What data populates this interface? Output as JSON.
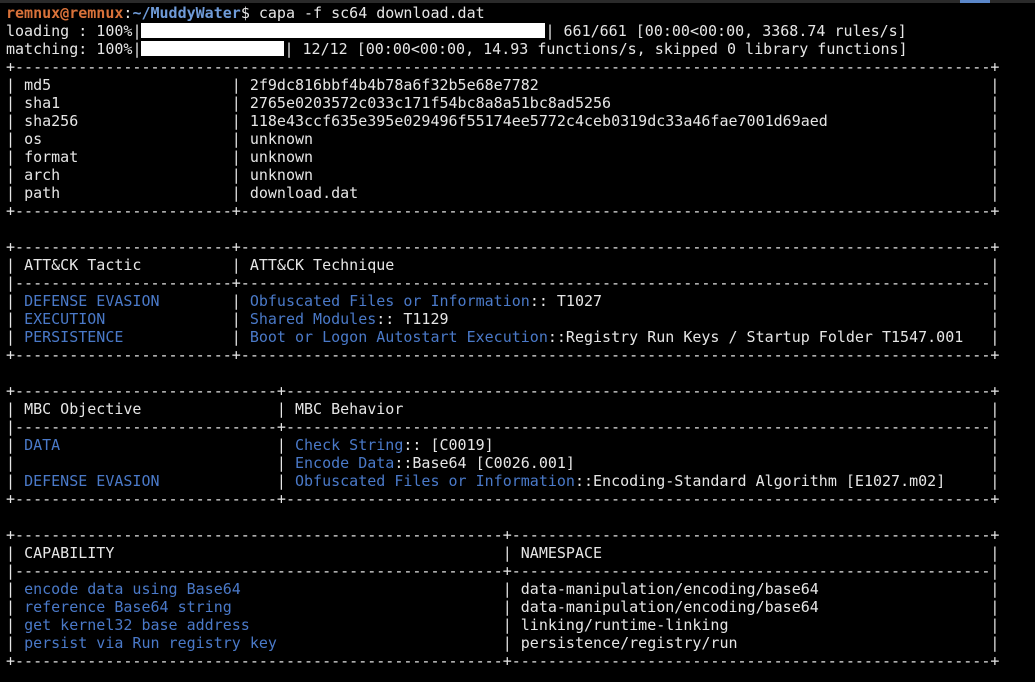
{
  "prompt": {
    "user_host": "remnux@remnux",
    "sep": ":",
    "cwd": "~/MuddyWater",
    "symbol": "$",
    "command": " capa -f sc64 download.dat"
  },
  "progress": [
    {
      "label": "loading : 100%",
      "percent": 100,
      "suffix": "| 661/661 [00:00<00:00, 3368.74 rules/s]"
    },
    {
      "label": "matching: 100%",
      "percent": 100,
      "suffix": "| 12/12 [00:00<00:00, 14.93 functions/s, skipped 0 library functions]"
    }
  ],
  "file_info": {
    "rows": [
      {
        "key": "md5",
        "value": "2f9dc816bbf4b4b78a6f32b5e68e7782"
      },
      {
        "key": "sha1",
        "value": "2765e0203572c033c171f54bc8a8a51bc8ad5256"
      },
      {
        "key": "sha256",
        "value": "118e43ccf635e395e029496f55174ee5772c4ceb0319dc33a46fae7001d69aed"
      },
      {
        "key": "os",
        "value": "unknown"
      },
      {
        "key": "format",
        "value": "unknown"
      },
      {
        "key": "arch",
        "value": "unknown"
      },
      {
        "key": "path",
        "value": "download.dat"
      }
    ]
  },
  "attack": {
    "headers": [
      "ATT&CK Tactic",
      "ATT&CK Technique"
    ],
    "rows": [
      {
        "tactic": "DEFENSE EVASION",
        "technique": "Obfuscated Files or Information",
        "id": ":: T1027"
      },
      {
        "tactic": "EXECUTION",
        "technique": "Shared Modules",
        "id": ":: T1129"
      },
      {
        "tactic": "PERSISTENCE",
        "technique": "Boot or Logon Autostart Execution",
        "id": "::Registry Run Keys / Startup Folder T1547.001"
      }
    ]
  },
  "mbc": {
    "headers": [
      "MBC Objective",
      "MBC Behavior"
    ],
    "rows": [
      {
        "objective": "DATA",
        "behavior": "Check String",
        "id": ":: [C0019]"
      },
      {
        "objective": "",
        "behavior": "Encode Data",
        "id": "::Base64 [C0026.001]"
      },
      {
        "objective": "DEFENSE EVASION",
        "behavior": "Obfuscated Files or Information",
        "id": "::Encoding-Standard Algorithm [E1027.m02]"
      }
    ]
  },
  "capabilities": {
    "headers": [
      "CAPABILITY",
      "NAMESPACE"
    ],
    "rows": [
      {
        "capability": "encode data using Base64",
        "namespace": "data-manipulation/encoding/base64"
      },
      {
        "capability": "reference Base64 string",
        "namespace": "data-manipulation/encoding/base64"
      },
      {
        "capability": "get kernel32 base address",
        "namespace": "linking/runtime-linking"
      },
      {
        "capability": "persist via Run registry key",
        "namespace": "persistence/registry/run"
      }
    ]
  },
  "colors": {
    "background": "#000000",
    "text": "#e6e6e6",
    "user_host": "#d9723a",
    "cwd": "#6f9bd8",
    "highlight": "#4a79c8",
    "progress_fill": "#ffffff"
  }
}
